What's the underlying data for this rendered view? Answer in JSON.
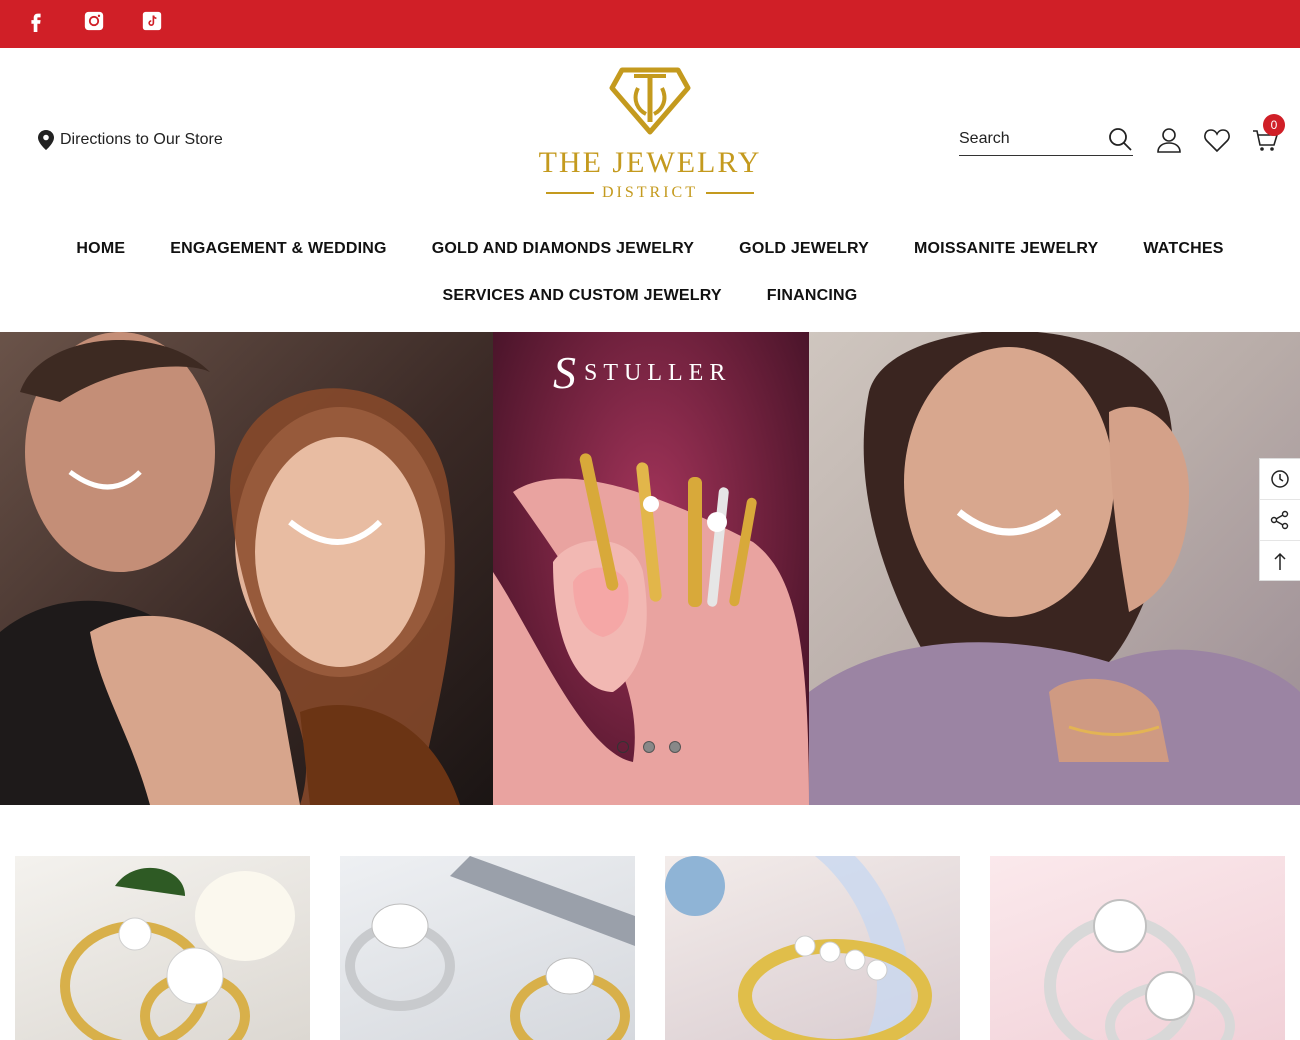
{
  "topbar": {
    "background": "#d01f27",
    "social": [
      {
        "icon": "facebook-icon"
      },
      {
        "icon": "instagram-icon"
      },
      {
        "icon": "tiktok-icon"
      }
    ]
  },
  "header": {
    "directions_label": "Directions to Our Store",
    "logo": {
      "title": "THE JEWELRY",
      "subtitle": "DISTRICT",
      "color": "#c49a1e"
    },
    "search": {
      "placeholder": "Search"
    },
    "cart_count": "0"
  },
  "nav": {
    "row1": [
      "HOME",
      "ENGAGEMENT & WEDDING",
      "GOLD AND DIAMONDS JEWELRY",
      "GOLD JEWELRY",
      "MOISSANITE JEWELRY",
      "WATCHES"
    ],
    "row2": [
      "SERVICES AND CUSTOM JEWELRY",
      "FINANCING"
    ]
  },
  "hero": {
    "brand_mark": "S",
    "brand_name": "STULLER",
    "slides_total": 3,
    "active_slide": 1
  },
  "side_tools": [
    "recently-viewed-icon",
    "share-icon",
    "back-to-top-icon"
  ]
}
